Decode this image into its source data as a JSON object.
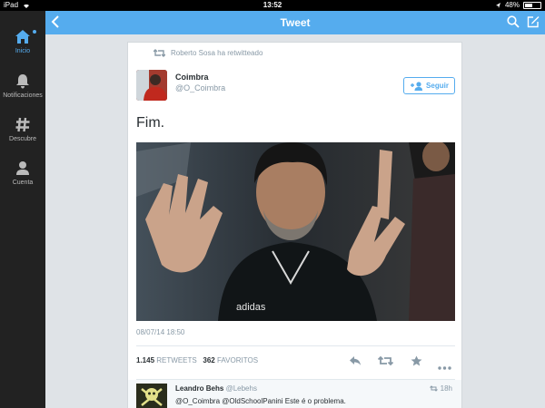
{
  "status_bar": {
    "device": "iPad",
    "time": "13:52",
    "battery": "48%",
    "battery_level": 0.48
  },
  "sidebar": {
    "items": [
      {
        "label": "Inicio",
        "icon": "home-icon"
      },
      {
        "label": "Notificaciones",
        "icon": "bell-icon"
      },
      {
        "label": "Descubre",
        "icon": "hashtag-icon"
      },
      {
        "label": "Cuenta",
        "icon": "person-icon"
      }
    ]
  },
  "header": {
    "title": "Tweet"
  },
  "tweet": {
    "retweeted_by": "Roberto Sosa ha retwitteado",
    "author_name": "Coimbra",
    "author_handle": "@O_Coimbra",
    "follow_label": "Seguir",
    "text": "Fim.",
    "timestamp": "08/07/14 18:50",
    "retweets_count": "1.145",
    "retweets_label": "RETWEETS",
    "favorites_count": "362",
    "favorites_label": "FAVORITOS"
  },
  "reply": {
    "name": "Leandro Behs",
    "handle": "@Lebehs",
    "time": "18h",
    "text": "@O_Coimbra @OldSchoolPanini Este é o problema."
  },
  "colors": {
    "accent": "#55acee",
    "sidebar": "#222222",
    "background": "#dfe3e7"
  }
}
